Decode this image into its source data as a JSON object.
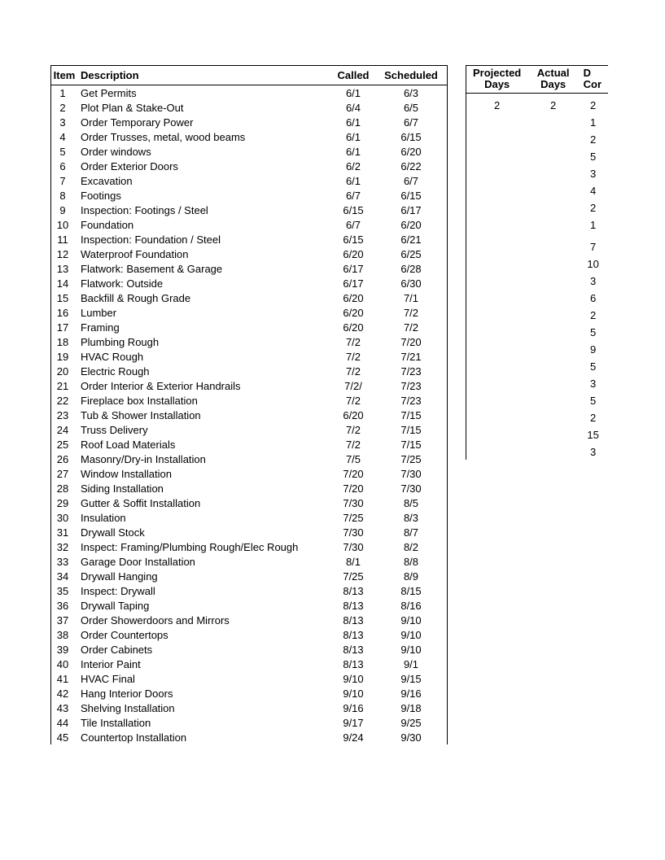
{
  "left": {
    "headers": {
      "item": "Item",
      "description": "Description",
      "called": "Called",
      "scheduled": "Scheduled"
    },
    "rows": [
      {
        "n": "1",
        "d": "Get Permits",
        "c": "6/1",
        "s": "6/3"
      },
      {
        "n": "2",
        "d": "Plot Plan & Stake-Out",
        "c": "6/4",
        "s": "6/5"
      },
      {
        "n": "3",
        "d": "Order Temporary Power",
        "c": "6/1",
        "s": "6/7"
      },
      {
        "n": "4",
        "d": "Order Trusses, metal, wood beams",
        "c": "6/1",
        "s": "6/15"
      },
      {
        "n": "5",
        "d": "Order windows",
        "c": "6/1",
        "s": "6/20"
      },
      {
        "n": "6",
        "d": "Order Exterior Doors",
        "c": "6/2",
        "s": "6/22"
      },
      {
        "n": "7",
        "d": "Excavation",
        "c": "6/1",
        "s": "6/7"
      },
      {
        "n": "8",
        "d": "Footings",
        "c": "6/7",
        "s": "6/15"
      },
      {
        "n": "9",
        "d": "Inspection: Footings / Steel",
        "c": "6/15",
        "s": "6/17"
      },
      {
        "n": "10",
        "d": "Foundation",
        "c": "6/7",
        "s": "6/20"
      },
      {
        "n": "11",
        "d": "Inspection: Foundation / Steel",
        "c": "6/15",
        "s": "6/21"
      },
      {
        "n": "12",
        "d": "Waterproof Foundation",
        "c": "6/20",
        "s": "6/25"
      },
      {
        "n": "13",
        "d": "Flatwork: Basement & Garage",
        "c": "6/17",
        "s": "6/28"
      },
      {
        "n": "14",
        "d": "Flatwork: Outside",
        "c": "6/17",
        "s": "6/30"
      },
      {
        "n": "15",
        "d": "Backfill & Rough Grade",
        "c": "6/20",
        "s": "7/1"
      },
      {
        "n": "16",
        "d": "Lumber",
        "c": "6/20",
        "s": "7/2"
      },
      {
        "n": "17",
        "d": "Framing",
        "c": "6/20",
        "s": "7/2"
      },
      {
        "n": "18",
        "d": "Plumbing Rough",
        "c": "7/2",
        "s": "7/20"
      },
      {
        "n": "19",
        "d": "HVAC Rough",
        "c": "7/2",
        "s": "7/21"
      },
      {
        "n": "20",
        "d": "Electric Rough",
        "c": "7/2",
        "s": "7/23"
      },
      {
        "n": "21",
        "d": "Order Interior & Exterior Handrails",
        "c": "7/2/",
        "s": "7/23"
      },
      {
        "n": "22",
        "d": "Fireplace box Installation",
        "c": "7/2",
        "s": "7/23"
      },
      {
        "n": "23",
        "d": "Tub & Shower Installation",
        "c": "6/20",
        "s": "7/15"
      },
      {
        "n": "24",
        "d": "Truss Delivery",
        "c": "7/2",
        "s": "7/15"
      },
      {
        "n": "25",
        "d": "Roof Load Materials",
        "c": "7/2",
        "s": "7/15"
      },
      {
        "n": "26",
        "d": "Masonry/Dry-in Installation",
        "c": "7/5",
        "s": "7/25"
      },
      {
        "n": "27",
        "d": "Window Installation",
        "c": "7/20",
        "s": "7/30"
      },
      {
        "n": "28",
        "d": "Siding Installation",
        "c": "7/20",
        "s": "7/30"
      },
      {
        "n": "29",
        "d": "Gutter & Soffit Installation",
        "c": "7/30",
        "s": "8/5"
      },
      {
        "n": "30",
        "d": "Insulation",
        "c": "7/25",
        "s": "8/3"
      },
      {
        "n": "31",
        "d": "Drywall Stock",
        "c": "7/30",
        "s": "8/7"
      },
      {
        "n": "32",
        "d": "Inspect: Framing/Plumbing Rough/Elec Rough",
        "c": "7/30",
        "s": "8/2"
      },
      {
        "n": "33",
        "d": "Garage Door Installation",
        "c": "8/1",
        "s": "8/8"
      },
      {
        "n": "34",
        "d": "Drywall Hanging",
        "c": "7/25",
        "s": "8/9"
      },
      {
        "n": "35",
        "d": "Inspect: Drywall",
        "c": "8/13",
        "s": "8/15"
      },
      {
        "n": "36",
        "d": "Drywall Taping",
        "c": "8/13",
        "s": "8/16"
      },
      {
        "n": "37",
        "d": "Order Showerdoors and Mirrors",
        "c": "8/13",
        "s": "9/10"
      },
      {
        "n": "38",
        "d": "Order Countertops",
        "c": "8/13",
        "s": "9/10"
      },
      {
        "n": "39",
        "d": "Order Cabinets",
        "c": "8/13",
        "s": "9/10"
      },
      {
        "n": "40",
        "d": "Interior Paint",
        "c": "8/13",
        "s": "9/1"
      },
      {
        "n": "41",
        "d": "HVAC Final",
        "c": "9/10",
        "s": "9/15"
      },
      {
        "n": "42",
        "d": "Hang Interior Doors",
        "c": "9/10",
        "s": "9/16"
      },
      {
        "n": "43",
        "d": "Shelving Installation",
        "c": "9/16",
        "s": "9/18"
      },
      {
        "n": "44",
        "d": "Tile Installation",
        "c": "9/17",
        "s": "9/25"
      },
      {
        "n": "45",
        "d": "Countertop Installation",
        "c": "9/24",
        "s": "9/30"
      }
    ]
  },
  "right": {
    "headers": {
      "projected_l1": "Projected",
      "projected_l2": "Days",
      "actual_l1": "Actual",
      "actual_l2": "Days",
      "cor_l1": "D",
      "cor_l2": "Cor"
    },
    "rows": [
      {
        "p": "",
        "a": "",
        "x": ""
      },
      {
        "p": "",
        "a": "",
        "x": ""
      },
      {
        "p": "2",
        "a": "2",
        "x": "2"
      },
      {
        "p": "",
        "a": "",
        "x": ""
      },
      {
        "p": "",
        "a": "",
        "x": "1"
      },
      {
        "p": "",
        "a": "",
        "x": ""
      },
      {
        "p": "",
        "a": "",
        "x": "2"
      },
      {
        "p": "",
        "a": "",
        "x": ""
      },
      {
        "p": "",
        "a": "",
        "x": "5"
      },
      {
        "p": "",
        "a": "",
        "x": ""
      },
      {
        "p": "",
        "a": "",
        "x": "3"
      },
      {
        "p": "",
        "a": "",
        "x": ""
      },
      {
        "p": "",
        "a": "",
        "x": "4"
      },
      {
        "p": "",
        "a": "",
        "x": ""
      },
      {
        "p": "",
        "a": "",
        "x": "2"
      },
      {
        "p": "",
        "a": "",
        "x": ""
      },
      {
        "p": "",
        "a": "",
        "x": "1"
      },
      {
        "p": "",
        "a": "",
        "x": ""
      },
      {
        "p": "",
        "a": "",
        "x": ""
      },
      {
        "p": "",
        "a": "",
        "x": ""
      },
      {
        "p": "",
        "a": "",
        "x": "7"
      },
      {
        "p": "",
        "a": "",
        "x": ""
      },
      {
        "p": "",
        "a": "",
        "x": "10"
      },
      {
        "p": "",
        "a": "",
        "x": ""
      },
      {
        "p": "",
        "a": "",
        "x": "3"
      },
      {
        "p": "",
        "a": "",
        "x": ""
      },
      {
        "p": "",
        "a": "",
        "x": "6"
      },
      {
        "p": "",
        "a": "",
        "x": ""
      },
      {
        "p": "",
        "a": "",
        "x": "2"
      },
      {
        "p": "",
        "a": "",
        "x": ""
      },
      {
        "p": "",
        "a": "",
        "x": "5"
      },
      {
        "p": "",
        "a": "",
        "x": ""
      },
      {
        "p": "",
        "a": "",
        "x": "9"
      },
      {
        "p": "",
        "a": "",
        "x": ""
      },
      {
        "p": "",
        "a": "",
        "x": "5"
      },
      {
        "p": "",
        "a": "",
        "x": ""
      },
      {
        "p": "",
        "a": "",
        "x": "3"
      },
      {
        "p": "",
        "a": "",
        "x": ""
      },
      {
        "p": "",
        "a": "",
        "x": "5"
      },
      {
        "p": "",
        "a": "",
        "x": ""
      },
      {
        "p": "",
        "a": "",
        "x": "2"
      },
      {
        "p": "",
        "a": "",
        "x": ""
      },
      {
        "p": "",
        "a": "",
        "x": "15"
      },
      {
        "p": "",
        "a": "",
        "x": ""
      },
      {
        "p": "",
        "a": "",
        "x": "3"
      }
    ]
  }
}
